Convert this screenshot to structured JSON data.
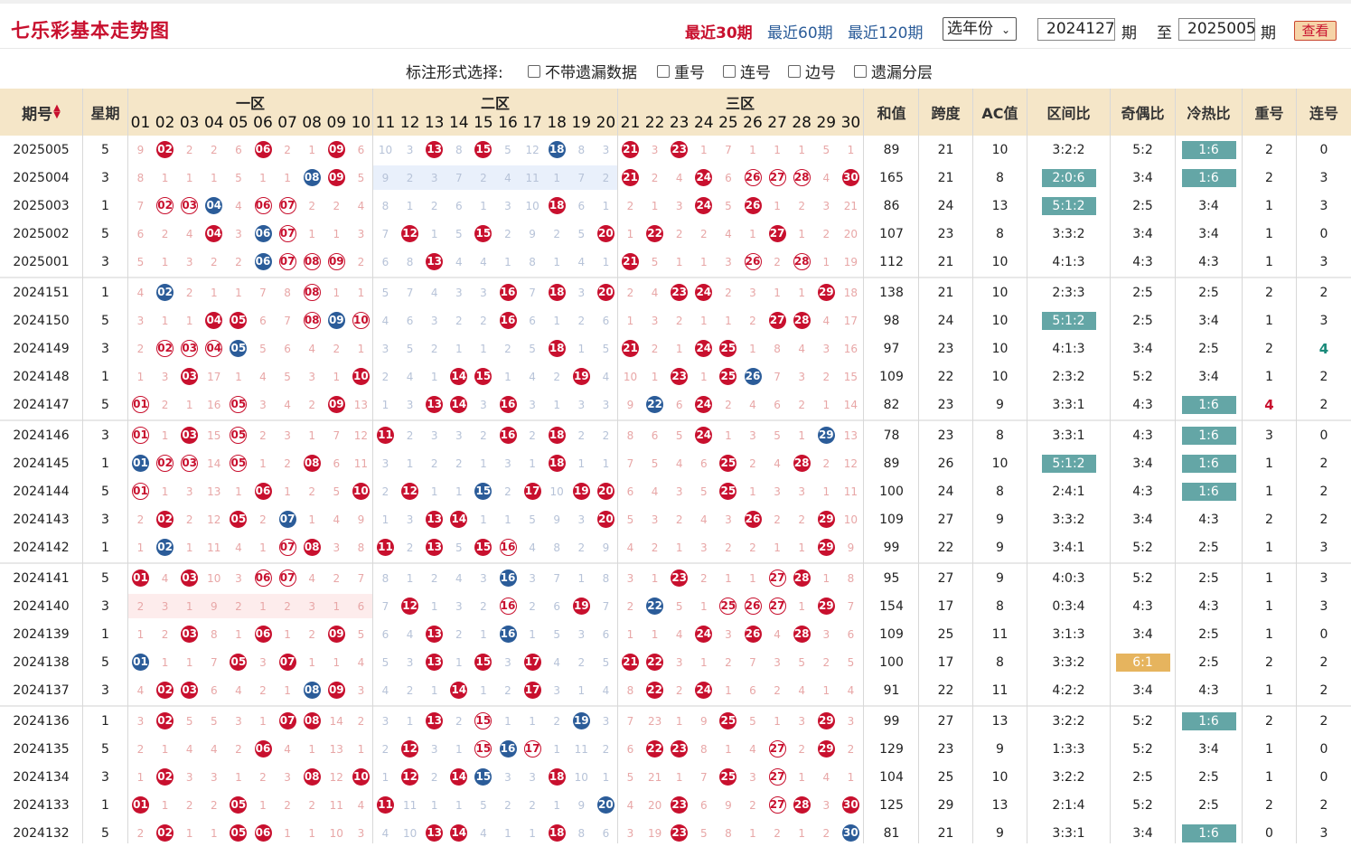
{
  "header": {
    "title": "七乐彩基本走势图",
    "period_links": [
      "最近30期",
      "最近60期",
      "最近120期"
    ],
    "year_select": "选年份",
    "from_issue": "2024127",
    "to_issue": "2025005",
    "issue_suffix": "期",
    "to_label": "至",
    "query_button": "查看"
  },
  "options": {
    "label": "标注形式选择:",
    "items": [
      "不带遗漏数据",
      "重号",
      "连号",
      "边号",
      "遗漏分层"
    ]
  },
  "table_header": {
    "issue": "期号",
    "weekday": "星期",
    "zones": [
      "一区",
      "二区",
      "三区"
    ],
    "numbers": [
      "01",
      "02",
      "03",
      "04",
      "05",
      "06",
      "07",
      "08",
      "09",
      "10",
      "11",
      "12",
      "13",
      "14",
      "15",
      "16",
      "17",
      "18",
      "19",
      "20",
      "21",
      "22",
      "23",
      "24",
      "25",
      "26",
      "27",
      "28",
      "29",
      "30"
    ],
    "stats": [
      "和值",
      "跨度",
      "AC值",
      "区间比",
      "奇偶比",
      "冷热比",
      "重号",
      "连号"
    ]
  },
  "colors": {
    "ball_red": "#c8102e",
    "ball_blue": "#2b5c99",
    "tag_teal": "#64a6a6",
    "tag_orange": "#e6b45e",
    "header_bg": "#f5e6c8"
  },
  "rows": [
    {
      "issue": "2025005",
      "week": "5",
      "cells": [
        "9",
        "02",
        "2",
        "2",
        "6",
        "06",
        "2",
        "1",
        "09",
        "6",
        "10",
        "3",
        "13",
        "8",
        "15",
        "5",
        "12",
        "B18",
        "8",
        "3",
        "21",
        "3",
        "23",
        "1",
        "7",
        "1",
        "1",
        "1",
        "5",
        "1"
      ],
      "sum": "89",
      "span": "21",
      "ac": "10",
      "zone_ratio": "3:2:2",
      "odd_even": "5:2",
      "cold_hot": "T1:6",
      "repeat": "2",
      "consec": "0"
    },
    {
      "issue": "2025004",
      "week": "3",
      "cells": [
        "8",
        "1",
        "1",
        "1",
        "5",
        "1",
        "1",
        "B08",
        "09",
        "5",
        "9",
        "2",
        "3",
        "7",
        "2",
        "4",
        "11",
        "1",
        "7",
        "2",
        "21",
        "2",
        "4",
        "24",
        "6",
        "R26",
        "R27",
        "R28",
        "4",
        "30"
      ],
      "sum": "165",
      "span": "21",
      "ac": "8",
      "zone_ratio": "T2:0:6",
      "odd_even": "3:4",
      "cold_hot": "T1:6",
      "repeat": "2",
      "consec": "3"
    },
    {
      "issue": "2025003",
      "week": "1",
      "cells": [
        "7",
        "R02",
        "R03",
        "B04",
        "4",
        "R06",
        "R07",
        "2",
        "2",
        "4",
        "8",
        "1",
        "2",
        "6",
        "1",
        "3",
        "10",
        "18",
        "6",
        "1",
        "2",
        "1",
        "3",
        "24",
        "5",
        "26",
        "1",
        "2",
        "3",
        "21"
      ],
      "sum": "86",
      "span": "24",
      "ac": "13",
      "zone_ratio": "T5:1:2",
      "odd_even": "2:5",
      "cold_hot": "3:4",
      "repeat": "1",
      "consec": "3"
    },
    {
      "issue": "2025002",
      "week": "5",
      "cells": [
        "6",
        "2",
        "4",
        "04",
        "3",
        "B06",
        "R07",
        "1",
        "1",
        "3",
        "7",
        "12",
        "1",
        "5",
        "15",
        "2",
        "9",
        "2",
        "5",
        "20",
        "1",
        "22",
        "2",
        "2",
        "4",
        "1",
        "27",
        "1",
        "2",
        "20"
      ],
      "sum": "107",
      "span": "23",
      "ac": "8",
      "zone_ratio": "3:3:2",
      "odd_even": "3:4",
      "cold_hot": "3:4",
      "repeat": "1",
      "consec": "0"
    },
    {
      "issue": "2025001",
      "week": "3",
      "cells": [
        "5",
        "1",
        "3",
        "2",
        "2",
        "B06",
        "R07",
        "R08",
        "R09",
        "2",
        "6",
        "8",
        "13",
        "4",
        "4",
        "1",
        "8",
        "1",
        "4",
        "1",
        "21",
        "5",
        "1",
        "1",
        "3",
        "R26",
        "2",
        "R28",
        "1",
        "19"
      ],
      "sum": "112",
      "span": "21",
      "ac": "10",
      "zone_ratio": "4:1:3",
      "odd_even": "4:3",
      "cold_hot": "4:3",
      "repeat": "1",
      "consec": "3"
    },
    {
      "issue": "2024151",
      "week": "1",
      "cells": [
        "4",
        "B02",
        "2",
        "1",
        "1",
        "7",
        "8",
        "R08",
        "1",
        "1",
        "5",
        "7",
        "4",
        "3",
        "3",
        "16",
        "7",
        "18",
        "3",
        "20",
        "2",
        "4",
        "23",
        "24",
        "2",
        "3",
        "1",
        "1",
        "29",
        "18"
      ],
      "sum": "138",
      "span": "21",
      "ac": "10",
      "zone_ratio": "2:3:3",
      "odd_even": "2:5",
      "cold_hot": "2:5",
      "repeat": "2",
      "consec": "2"
    },
    {
      "issue": "2024150",
      "week": "5",
      "cells": [
        "3",
        "1",
        "1",
        "04",
        "05",
        "6",
        "7",
        "R08",
        "B09",
        "R10",
        "4",
        "6",
        "3",
        "2",
        "2",
        "16",
        "6",
        "1",
        "2",
        "6",
        "1",
        "3",
        "2",
        "1",
        "1",
        "2",
        "27",
        "28",
        "4",
        "17"
      ],
      "sum": "98",
      "span": "24",
      "ac": "10",
      "zone_ratio": "T5:1:2",
      "odd_even": "2:5",
      "cold_hot": "3:4",
      "repeat": "1",
      "consec": "3"
    },
    {
      "issue": "2024149",
      "week": "3",
      "cells": [
        "2",
        "R02",
        "R03",
        "R04",
        "B05",
        "5",
        "6",
        "4",
        "2",
        "1",
        "3",
        "5",
        "2",
        "1",
        "1",
        "2",
        "5",
        "18",
        "1",
        "5",
        "21",
        "2",
        "1",
        "24",
        "25",
        "1",
        "8",
        "4",
        "3",
        "16"
      ],
      "sum": "97",
      "span": "23",
      "ac": "10",
      "zone_ratio": "4:1:3",
      "odd_even": "3:4",
      "cold_hot": "2:5",
      "repeat": "2",
      "consec": "G4"
    },
    {
      "issue": "2024148",
      "week": "1",
      "cells": [
        "1",
        "3",
        "03",
        "17",
        "1",
        "4",
        "5",
        "3",
        "1",
        "10",
        "2",
        "4",
        "1",
        "14",
        "15",
        "1",
        "4",
        "2",
        "19",
        "4",
        "10",
        "1",
        "23",
        "1",
        "25",
        "B26",
        "7",
        "3",
        "2",
        "15"
      ],
      "sum": "109",
      "span": "22",
      "ac": "10",
      "zone_ratio": "2:3:2",
      "odd_even": "5:2",
      "cold_hot": "3:4",
      "repeat": "1",
      "consec": "2"
    },
    {
      "issue": "2024147",
      "week": "5",
      "cells": [
        "R01",
        "2",
        "1",
        "16",
        "R05",
        "3",
        "4",
        "2",
        "09",
        "13",
        "1",
        "3",
        "13",
        "14",
        "3",
        "16",
        "3",
        "1",
        "3",
        "3",
        "9",
        "B22",
        "6",
        "24",
        "2",
        "4",
        "6",
        "2",
        "1",
        "14"
      ],
      "sum": "82",
      "span": "23",
      "ac": "9",
      "zone_ratio": "3:3:1",
      "odd_even": "4:3",
      "cold_hot": "T1:6",
      "repeat": "P4",
      "consec": "2"
    },
    {
      "issue": "2024146",
      "week": "3",
      "cells": [
        "R01",
        "1",
        "03",
        "15",
        "R05",
        "2",
        "3",
        "1",
        "7",
        "12",
        "11",
        "2",
        "3",
        "3",
        "2",
        "16",
        "2",
        "18",
        "2",
        "2",
        "8",
        "6",
        "5",
        "24",
        "1",
        "3",
        "5",
        "1",
        "B29",
        "13"
      ],
      "sum": "78",
      "span": "23",
      "ac": "8",
      "zone_ratio": "3:3:1",
      "odd_even": "4:3",
      "cold_hot": "T1:6",
      "repeat": "3",
      "consec": "0"
    },
    {
      "issue": "2024145",
      "week": "1",
      "cells": [
        "B01",
        "R02",
        "R03",
        "14",
        "R05",
        "1",
        "2",
        "08",
        "6",
        "11",
        "3",
        "1",
        "2",
        "2",
        "1",
        "3",
        "1",
        "18",
        "1",
        "1",
        "7",
        "5",
        "4",
        "6",
        "25",
        "2",
        "4",
        "28",
        "2",
        "12"
      ],
      "sum": "89",
      "span": "26",
      "ac": "10",
      "zone_ratio": "T5:1:2",
      "odd_even": "3:4",
      "cold_hot": "T1:6",
      "repeat": "1",
      "consec": "2"
    },
    {
      "issue": "2024144",
      "week": "5",
      "cells": [
        "R01",
        "1",
        "3",
        "13",
        "1",
        "06",
        "1",
        "2",
        "5",
        "10",
        "2",
        "12",
        "1",
        "1",
        "B15",
        "2",
        "17",
        "10",
        "19",
        "20",
        "6",
        "4",
        "3",
        "5",
        "25",
        "1",
        "3",
        "3",
        "1",
        "11"
      ],
      "sum": "100",
      "span": "24",
      "ac": "8",
      "zone_ratio": "2:4:1",
      "odd_even": "4:3",
      "cold_hot": "T1:6",
      "repeat": "1",
      "consec": "2"
    },
    {
      "issue": "2024143",
      "week": "3",
      "cells": [
        "2",
        "02",
        "2",
        "12",
        "05",
        "2",
        "B07",
        "1",
        "4",
        "9",
        "1",
        "3",
        "13",
        "14",
        "1",
        "1",
        "5",
        "9",
        "3",
        "20",
        "5",
        "3",
        "2",
        "4",
        "3",
        "26",
        "2",
        "2",
        "29",
        "10"
      ],
      "sum": "109",
      "span": "27",
      "ac": "9",
      "zone_ratio": "3:3:2",
      "odd_even": "3:4",
      "cold_hot": "4:3",
      "repeat": "2",
      "consec": "2"
    },
    {
      "issue": "2024142",
      "week": "1",
      "cells": [
        "1",
        "B02",
        "1",
        "11",
        "4",
        "1",
        "R07",
        "08",
        "3",
        "8",
        "11",
        "2",
        "13",
        "5",
        "15",
        "R16",
        "4",
        "8",
        "2",
        "9",
        "4",
        "2",
        "1",
        "3",
        "2",
        "2",
        "1",
        "1",
        "29",
        "9"
      ],
      "sum": "99",
      "span": "22",
      "ac": "9",
      "zone_ratio": "3:4:1",
      "odd_even": "5:2",
      "cold_hot": "2:5",
      "repeat": "1",
      "consec": "3"
    },
    {
      "issue": "2024141",
      "week": "5",
      "cells": [
        "01",
        "4",
        "03",
        "10",
        "3",
        "R06",
        "R07",
        "4",
        "2",
        "7",
        "8",
        "1",
        "2",
        "4",
        "3",
        "B16",
        "3",
        "7",
        "1",
        "8",
        "3",
        "1",
        "23",
        "2",
        "1",
        "1",
        "R27",
        "28",
        "1",
        "8"
      ],
      "sum": "95",
      "span": "27",
      "ac": "9",
      "zone_ratio": "4:0:3",
      "odd_even": "5:2",
      "cold_hot": "2:5",
      "repeat": "1",
      "consec": "3"
    },
    {
      "issue": "2024140",
      "week": "3",
      "cells": [
        "2",
        "3",
        "1",
        "9",
        "2",
        "1",
        "2",
        "3",
        "1",
        "6",
        "7",
        "12",
        "1",
        "3",
        "2",
        "R16",
        "2",
        "6",
        "19",
        "7",
        "2",
        "B22",
        "5",
        "1",
        "R25",
        "R26",
        "R27",
        "1",
        "29",
        "7"
      ],
      "sum": "154",
      "span": "17",
      "ac": "8",
      "zone_ratio": "0:3:4",
      "odd_even": "4:3",
      "cold_hot": "4:3",
      "repeat": "1",
      "consec": "3"
    },
    {
      "issue": "2024139",
      "week": "1",
      "cells": [
        "1",
        "2",
        "03",
        "8",
        "1",
        "06",
        "1",
        "2",
        "09",
        "5",
        "6",
        "4",
        "13",
        "2",
        "1",
        "B16",
        "1",
        "5",
        "3",
        "6",
        "1",
        "1",
        "4",
        "24",
        "3",
        "26",
        "4",
        "28",
        "3",
        "6"
      ],
      "sum": "109",
      "span": "25",
      "ac": "11",
      "zone_ratio": "3:1:3",
      "odd_even": "3:4",
      "cold_hot": "2:5",
      "repeat": "1",
      "consec": "0"
    },
    {
      "issue": "2024138",
      "week": "5",
      "cells": [
        "B01",
        "1",
        "1",
        "7",
        "05",
        "3",
        "07",
        "1",
        "1",
        "4",
        "5",
        "3",
        "13",
        "1",
        "15",
        "3",
        "17",
        "4",
        "2",
        "5",
        "21",
        "22",
        "3",
        "1",
        "2",
        "7",
        "3",
        "5",
        "2",
        "5"
      ],
      "sum": "100",
      "span": "17",
      "ac": "8",
      "zone_ratio": "3:3:2",
      "odd_even": "O6:1",
      "cold_hot": "2:5",
      "repeat": "2",
      "consec": "2"
    },
    {
      "issue": "2024137",
      "week": "3",
      "cells": [
        "4",
        "02",
        "03",
        "6",
        "4",
        "2",
        "1",
        "B08",
        "09",
        "3",
        "4",
        "2",
        "1",
        "14",
        "1",
        "2",
        "17",
        "3",
        "1",
        "4",
        "8",
        "22",
        "2",
        "24",
        "1",
        "6",
        "2",
        "4",
        "1",
        "4"
      ],
      "sum": "91",
      "span": "22",
      "ac": "11",
      "zone_ratio": "4:2:2",
      "odd_even": "3:4",
      "cold_hot": "4:3",
      "repeat": "1",
      "consec": "2"
    },
    {
      "issue": "2024136",
      "week": "1",
      "cells": [
        "3",
        "02",
        "5",
        "5",
        "3",
        "1",
        "07",
        "08",
        "14",
        "2",
        "3",
        "1",
        "13",
        "2",
        "R15",
        "1",
        "1",
        "2",
        "B19",
        "3",
        "7",
        "23",
        "1",
        "9",
        "25",
        "5",
        "1",
        "3",
        "29",
        "3"
      ],
      "sum": "99",
      "span": "27",
      "ac": "13",
      "zone_ratio": "3:2:2",
      "odd_even": "5:2",
      "cold_hot": "T1:6",
      "repeat": "2",
      "consec": "2"
    },
    {
      "issue": "2024135",
      "week": "5",
      "cells": [
        "2",
        "1",
        "4",
        "4",
        "2",
        "06",
        "4",
        "1",
        "13",
        "1",
        "2",
        "12",
        "3",
        "1",
        "R15",
        "B16",
        "R17",
        "1",
        "11",
        "2",
        "6",
        "22",
        "23",
        "8",
        "1",
        "4",
        "R27",
        "2",
        "29",
        "2"
      ],
      "sum": "129",
      "span": "23",
      "ac": "9",
      "zone_ratio": "1:3:3",
      "odd_even": "5:2",
      "cold_hot": "3:4",
      "repeat": "1",
      "consec": "0"
    },
    {
      "issue": "2024134",
      "week": "3",
      "cells": [
        "1",
        "02",
        "3",
        "3",
        "1",
        "2",
        "3",
        "08",
        "12",
        "10",
        "1",
        "12",
        "2",
        "14",
        "B15",
        "3",
        "3",
        "18",
        "10",
        "1",
        "5",
        "21",
        "1",
        "7",
        "25",
        "3",
        "R27",
        "1",
        "4",
        "1"
      ],
      "sum": "104",
      "span": "25",
      "ac": "10",
      "zone_ratio": "3:2:2",
      "odd_even": "2:5",
      "cold_hot": "2:5",
      "repeat": "1",
      "consec": "0"
    },
    {
      "issue": "2024133",
      "week": "1",
      "cells": [
        "01",
        "1",
        "2",
        "2",
        "05",
        "1",
        "2",
        "2",
        "11",
        "4",
        "11",
        "11",
        "1",
        "1",
        "5",
        "2",
        "2",
        "1",
        "9",
        "B20",
        "4",
        "20",
        "23",
        "6",
        "9",
        "2",
        "R27",
        "28",
        "3",
        "30"
      ],
      "sum": "125",
      "span": "29",
      "ac": "13",
      "zone_ratio": "2:1:4",
      "odd_even": "5:2",
      "cold_hot": "2:5",
      "repeat": "2",
      "consec": "2"
    },
    {
      "issue": "2024132",
      "week": "5",
      "cells": [
        "2",
        "02",
        "1",
        "1",
        "05",
        "06",
        "1",
        "1",
        "10",
        "3",
        "4",
        "10",
        "13",
        "14",
        "4",
        "1",
        "1",
        "18",
        "8",
        "6",
        "3",
        "19",
        "23",
        "5",
        "8",
        "1",
        "2",
        "1",
        "2",
        "B30"
      ],
      "sum": "81",
      "span": "21",
      "ac": "9",
      "zone_ratio": "3:3:1",
      "odd_even": "3:4",
      "cold_hot": "T1:6",
      "repeat": "0",
      "consec": "3"
    }
  ]
}
